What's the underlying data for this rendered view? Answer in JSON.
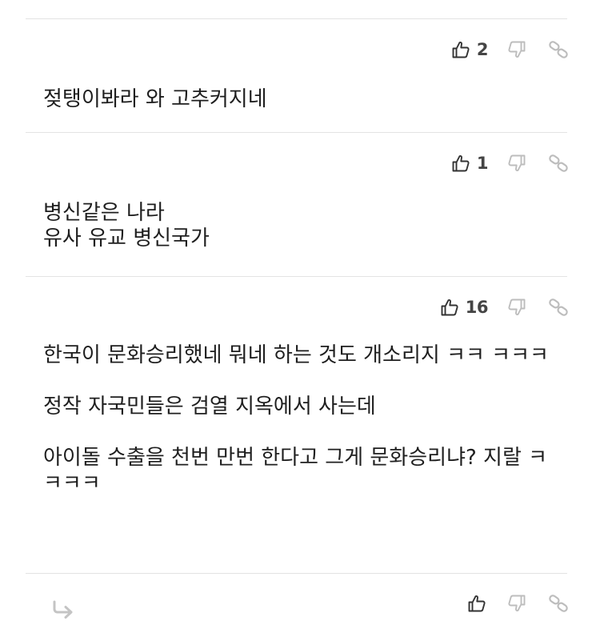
{
  "comments": [
    {
      "likes": "2",
      "text": [
        "젖탱이봐라 와 고추커지네"
      ]
    },
    {
      "likes": "1",
      "text": [
        "병신같은 나라\n유사 유교 병신국가"
      ]
    },
    {
      "likes": "16",
      "text": [
        "한국이 문화승리했네 뭐네 하는 것도 개소리지 ㅋㅋ ㅋㅋㅋ",
        "정작 자국민들은 검열 지옥에서 사는데",
        "아이돌 수출을 천번 만번 한다고 그게 문화승리냐? 지랄 ㅋㅋㅋㅋ"
      ]
    }
  ],
  "footer": {
    "likes": ""
  },
  "icons": {
    "like": "thumbs-up-icon",
    "dislike": "thumbs-down-icon",
    "link": "link-icon",
    "reply": "reply-arrow-icon"
  },
  "colors": {
    "icon_dark": "#333333",
    "icon_light": "#bdbdbd",
    "divider": "#e3e3e3"
  }
}
